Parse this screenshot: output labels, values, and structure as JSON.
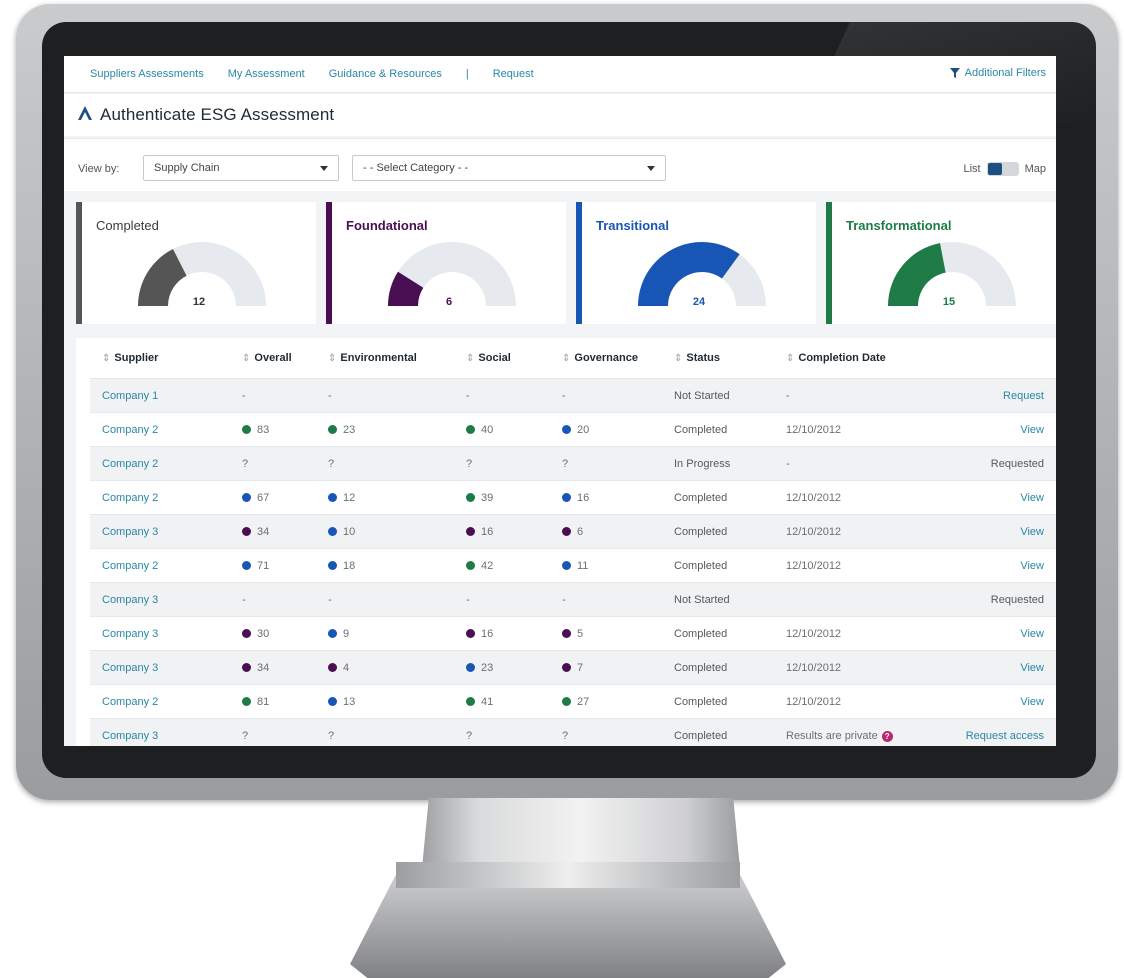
{
  "colors": {
    "foundational": "#4a0f52",
    "transitional": "#1856b5",
    "transformational": "#1e7b45",
    "completed": "#555555",
    "gauge_track": "#e6e9ee",
    "link": "#2a87a6"
  },
  "nav": {
    "items": [
      "Suppliers Assessments",
      "My Assessment",
      "Guidance & Resources",
      "Request"
    ],
    "separator": "|",
    "filters_label": "Additional Filters"
  },
  "header": {
    "title": "Authenticate ESG Assessment"
  },
  "viewby": {
    "label": "View by:",
    "chain_value": "Supply Chain",
    "category_value": "- - Select Category - -",
    "toggle_left": "List",
    "toggle_right": "Map"
  },
  "cards": [
    {
      "label": "Completed",
      "value": "12",
      "fill": 0.35,
      "color": "#555555"
    },
    {
      "label": "Foundational",
      "value": "6",
      "fill": 0.18,
      "color": "#4a0f52"
    },
    {
      "label": "Transitional",
      "value": "24",
      "fill": 0.7,
      "color": "#1856b5"
    },
    {
      "label": "Transformational",
      "value": "15",
      "fill": 0.44,
      "color": "#1e7b45"
    }
  ],
  "table": {
    "headers": [
      "Supplier",
      "Overall",
      "Environmental",
      "Social",
      "Governance",
      "Status",
      "Completion Date"
    ],
    "rows": [
      {
        "supplier": "Company 1",
        "scores": [
          [
            "-",
            ""
          ],
          [
            "-",
            ""
          ],
          [
            "-",
            ""
          ],
          [
            "-",
            ""
          ]
        ],
        "status": "Not Started",
        "date": "-",
        "action": "Request",
        "action_type": "link"
      },
      {
        "supplier": "Company 2",
        "scores": [
          [
            "83",
            "transformational"
          ],
          [
            "23",
            "transformational"
          ],
          [
            "40",
            "transformational"
          ],
          [
            "20",
            "transitional"
          ]
        ],
        "status": "Completed",
        "date": "12/10/2012",
        "action": "View",
        "action_type": "link"
      },
      {
        "supplier": "Company 2",
        "scores": [
          [
            "?",
            ""
          ],
          [
            "?",
            ""
          ],
          [
            "?",
            ""
          ],
          [
            "?",
            ""
          ]
        ],
        "status": "In Progress",
        "date": "-",
        "action": "Requested",
        "action_type": "plain"
      },
      {
        "supplier": "Company 2",
        "scores": [
          [
            "67",
            "transitional"
          ],
          [
            "12",
            "transitional"
          ],
          [
            "39",
            "transformational"
          ],
          [
            "16",
            "transitional"
          ]
        ],
        "status": "Completed",
        "date": "12/10/2012",
        "action": "View",
        "action_type": "link"
      },
      {
        "supplier": "Company 3",
        "scores": [
          [
            "34",
            "foundational"
          ],
          [
            "10",
            "transitional"
          ],
          [
            "16",
            "foundational"
          ],
          [
            "6",
            "foundational"
          ]
        ],
        "status": "Completed",
        "date": "12/10/2012",
        "action": "View",
        "action_type": "link"
      },
      {
        "supplier": "Company 2",
        "scores": [
          [
            "71",
            "transitional"
          ],
          [
            "18",
            "transitional"
          ],
          [
            "42",
            "transformational"
          ],
          [
            "11",
            "transitional"
          ]
        ],
        "status": "Completed",
        "date": "12/10/2012",
        "action": "View",
        "action_type": "link"
      },
      {
        "supplier": "Company 3",
        "scores": [
          [
            "-",
            ""
          ],
          [
            "-",
            ""
          ],
          [
            "-",
            ""
          ],
          [
            "-",
            ""
          ]
        ],
        "status": "Not Started",
        "date": "",
        "action": "Requested",
        "action_type": "plain"
      },
      {
        "supplier": "Company 3",
        "scores": [
          [
            "30",
            "foundational"
          ],
          [
            "9",
            "transitional"
          ],
          [
            "16",
            "foundational"
          ],
          [
            "5",
            "foundational"
          ]
        ],
        "status": "Completed",
        "date": "12/10/2012",
        "action": "View",
        "action_type": "link"
      },
      {
        "supplier": "Company 3",
        "scores": [
          [
            "34",
            "foundational"
          ],
          [
            "4",
            "foundational"
          ],
          [
            "23",
            "transitional"
          ],
          [
            "7",
            "foundational"
          ]
        ],
        "status": "Completed",
        "date": "12/10/2012",
        "action": "View",
        "action_type": "link"
      },
      {
        "supplier": "Company 2",
        "scores": [
          [
            "81",
            "transformational"
          ],
          [
            "13",
            "transitional"
          ],
          [
            "41",
            "transformational"
          ],
          [
            "27",
            "transformational"
          ]
        ],
        "status": "Completed",
        "date": "12/10/2012",
        "action": "View",
        "action_type": "link"
      },
      {
        "supplier": "Company 3",
        "scores": [
          [
            "?",
            ""
          ],
          [
            "?",
            ""
          ],
          [
            "?",
            ""
          ],
          [
            "?",
            ""
          ]
        ],
        "status": "Completed",
        "date": "Results are private",
        "date_help": "?",
        "action": "Request access",
        "action_type": "link"
      }
    ]
  }
}
